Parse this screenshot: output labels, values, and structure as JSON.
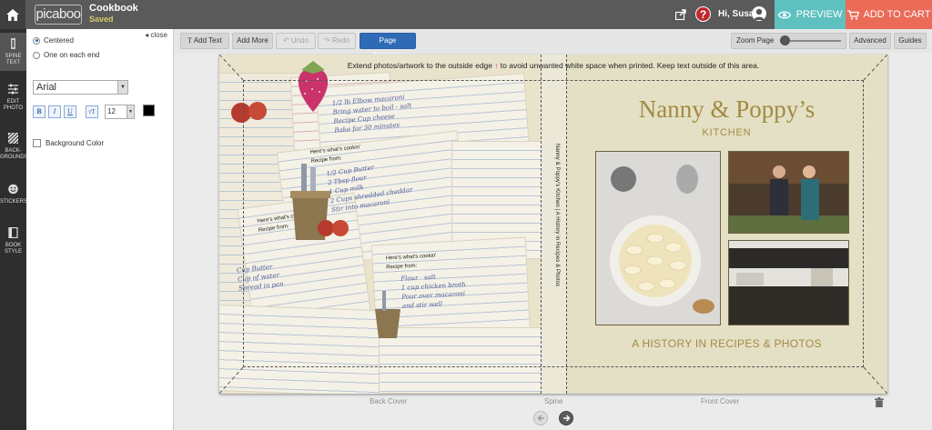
{
  "app": {
    "logo": "picaboo",
    "project_title": "Cookbook",
    "save_status": "Saved"
  },
  "header": {
    "greeting": "Hi, Susan",
    "help_label": "?",
    "preview_label": "PREVIEW",
    "cart_label": "ADD TO CART"
  },
  "rail": {
    "items": [
      {
        "label": "SPINE TEXT"
      },
      {
        "label": "EDIT PHOTO"
      },
      {
        "label": "BACK-GROUNDS"
      },
      {
        "label": "STICKERS"
      },
      {
        "label": "BOOK STYLE"
      }
    ]
  },
  "panel": {
    "close_label": "◂ close",
    "align_option_1": "Centered",
    "align_option_2": "One on each end",
    "align_selected": "Centered",
    "font_family": "Arial",
    "bold_label": "B",
    "italic_label": "I",
    "underline_label": "U",
    "capitalize_label": "ᴛT",
    "font_size": "12",
    "text_color": "#000000",
    "background_color_label": "Background Color",
    "background_color_checked": false
  },
  "toolbar": {
    "add_text": "Add Text",
    "add_more": "Add More",
    "undo": "Undo",
    "redo": "Redo",
    "page_manager": "Page Manager",
    "zoom_label": "Zoom Page",
    "advanced": "Advanced",
    "guides": "Guides"
  },
  "canvas": {
    "banner_prefix": "Extend photos/artwork to the outside edge",
    "banner_suffix": "to avoid unwanted white space when printed. Keep text outside of this area.",
    "spine_text": "Nanny & Poppy's Kitchen | A History in Recipes & Photos",
    "front_title": "Nanny & Poppy’s",
    "front_subtitle": "KITCHEN",
    "front_tagline": "A HISTORY IN RECIPES & PHOTOS",
    "back_card_1": "Here's what's cookin'\nRecipe from:",
    "back_card_2": "Here's what's cookin'\nRecipe from:",
    "back_card_3": "Here's what's cookin'\nRecipe from:"
  },
  "footer": {
    "back_cover_label": "Back Cover",
    "spine_label": "Spine",
    "front_cover_label": "Front Cover"
  },
  "colors": {
    "accent_blue": "#2e6ab5",
    "preview_teal": "#5ec1c0",
    "cart_coral": "#ea6b57",
    "title_gold": "#a28a43"
  }
}
